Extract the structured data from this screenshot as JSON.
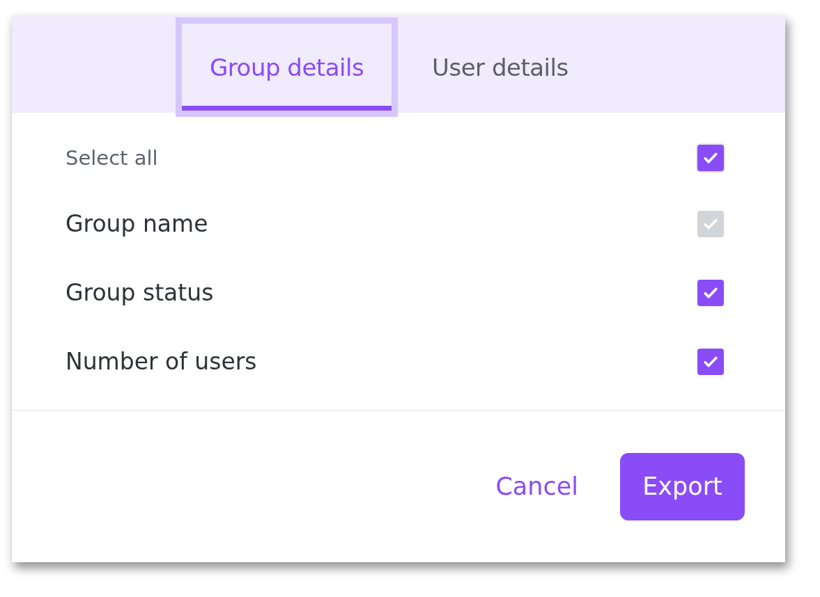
{
  "tabs": [
    {
      "label": "Group details",
      "selected": true,
      "focused": true
    },
    {
      "label": "User details",
      "selected": false,
      "focused": false
    }
  ],
  "select_all": {
    "label": "Select all",
    "checked": true
  },
  "options": [
    {
      "label": "Group name",
      "checked": true,
      "disabled": true
    },
    {
      "label": "Group status",
      "checked": true,
      "disabled": false
    },
    {
      "label": "Number of users",
      "checked": true,
      "disabled": false
    }
  ],
  "buttons": {
    "cancel": "Cancel",
    "export": "Export"
  }
}
